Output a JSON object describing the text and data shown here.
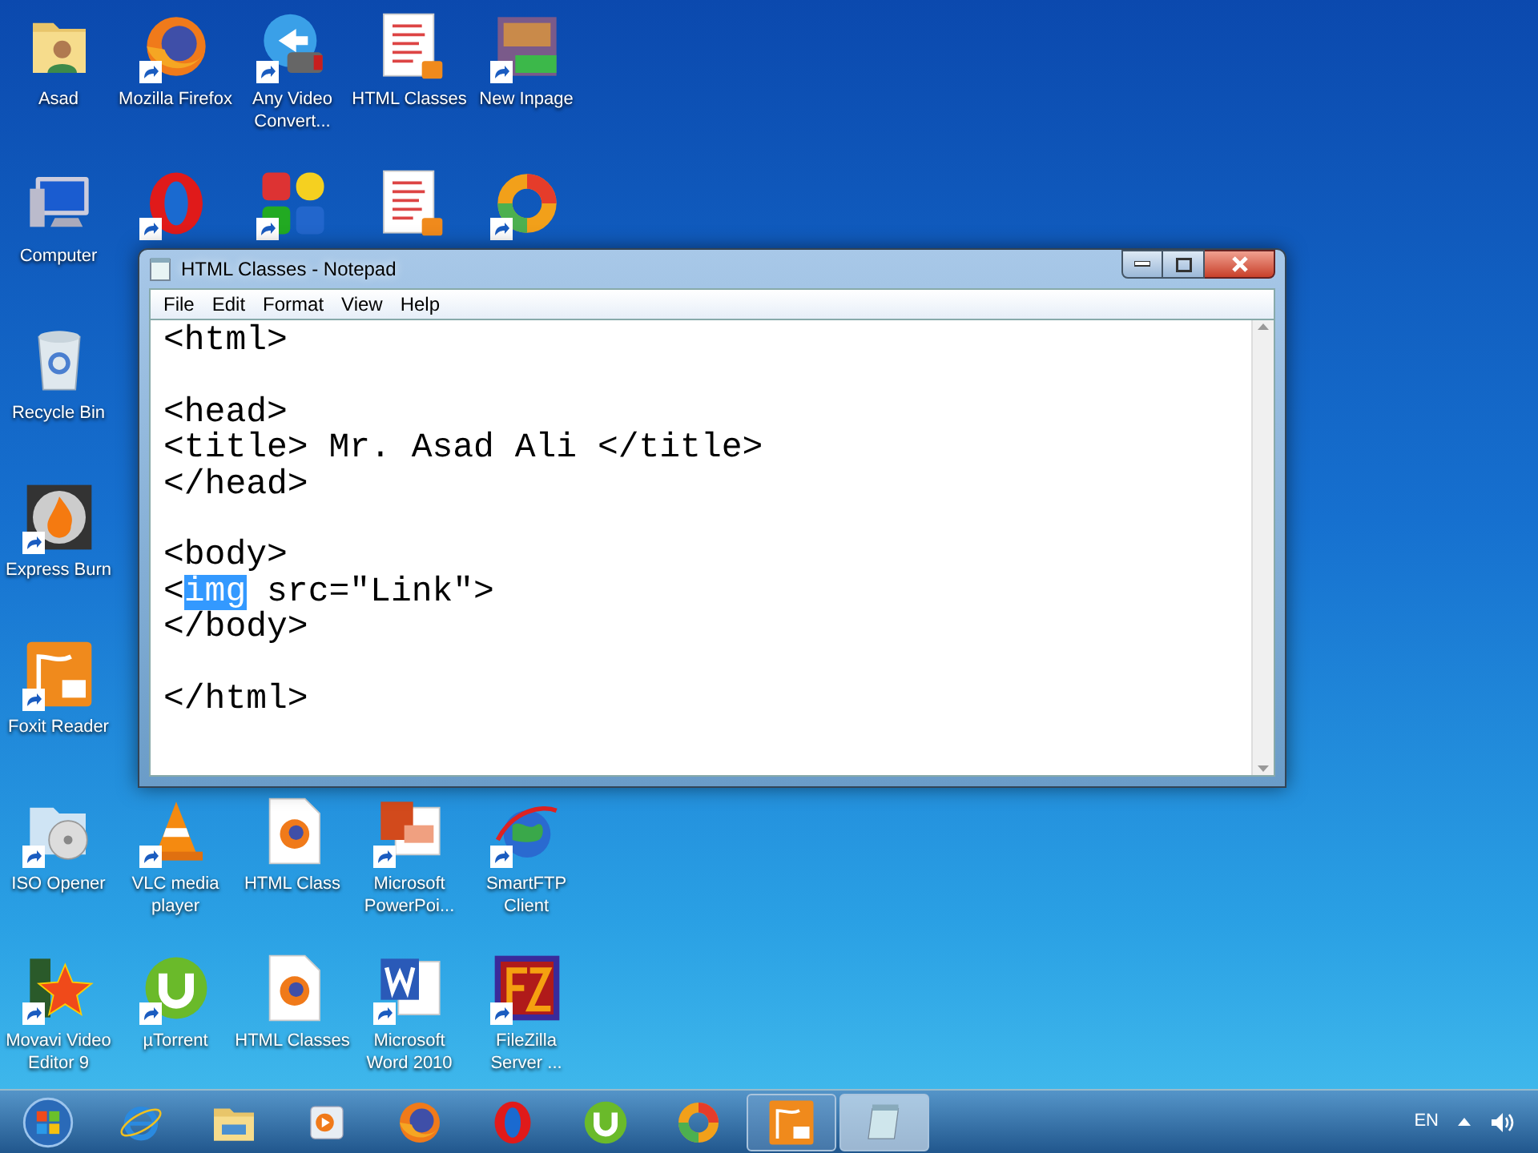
{
  "desktop": {
    "icon_rows": [
      [
        {
          "kind": "user-folder",
          "label": "Asad",
          "shortcut": false
        },
        {
          "kind": "firefox",
          "label": "Mozilla Firefox",
          "shortcut": true
        },
        {
          "kind": "video-converter",
          "label": "Any Video Convert...",
          "shortcut": true
        },
        {
          "kind": "pdf-doc",
          "label": "HTML Classes",
          "shortcut": false
        },
        {
          "kind": "inpage",
          "label": "New Inpage",
          "shortcut": true
        }
      ],
      [
        {
          "kind": "computer",
          "label": "Computer",
          "shortcut": false
        },
        {
          "kind": "opera",
          "shortcut": true
        },
        {
          "kind": "four-squares",
          "shortcut": true
        },
        {
          "kind": "pdf-doc",
          "shortcut": false
        },
        {
          "kind": "ring",
          "shortcut": true
        }
      ],
      [
        {
          "kind": "recycle-bin",
          "label": "Recycle Bin",
          "shortcut": false
        }
      ],
      [
        {
          "kind": "flame",
          "label": "Express Burn",
          "shortcut": true
        }
      ],
      [
        {
          "kind": "foxit",
          "label": "Foxit Reader",
          "shortcut": true
        }
      ],
      [
        {
          "kind": "disc-folder",
          "label": "ISO Opener",
          "shortcut": true
        },
        {
          "kind": "cone",
          "label": "VLC media player",
          "shortcut": true
        },
        {
          "kind": "web-doc",
          "label": "HTML Class",
          "shortcut": false
        },
        {
          "kind": "presentation",
          "label": "Microsoft PowerPoi...",
          "shortcut": true
        },
        {
          "kind": "globe",
          "label": "SmartFTP Client",
          "shortcut": true
        }
      ],
      [
        {
          "kind": "star-film",
          "label": "Movavi Video Editor 9",
          "shortcut": true
        },
        {
          "kind": "utorrent",
          "label": "µTorrent",
          "shortcut": true
        },
        {
          "kind": "web-doc",
          "label": "HTML Classes",
          "shortcut": false
        },
        {
          "kind": "word",
          "label": "Microsoft Word 2010",
          "shortcut": true
        },
        {
          "kind": "ftp-server",
          "label": "FileZilla Server ...",
          "shortcut": true
        }
      ]
    ]
  },
  "window": {
    "title": "HTML Classes - Notepad",
    "menu": [
      "File",
      "Edit",
      "Format",
      "View",
      "Help"
    ],
    "lines": [
      {
        "kind": "text",
        "segments": [
          {
            "text": "<html>",
            "selected": false
          }
        ]
      },
      {
        "kind": "blank"
      },
      {
        "kind": "text",
        "segments": [
          {
            "text": "<head>",
            "selected": false
          }
        ]
      },
      {
        "kind": "text",
        "segments": [
          {
            "text": "<title> Mr. Asad Ali </title>",
            "selected": false
          }
        ]
      },
      {
        "kind": "text",
        "segments": [
          {
            "text": "</head>",
            "selected": false
          }
        ]
      },
      {
        "kind": "blank"
      },
      {
        "kind": "text",
        "segments": [
          {
            "text": "<body>",
            "selected": false
          }
        ]
      },
      {
        "kind": "text",
        "segments": [
          {
            "text": "<",
            "selected": false
          },
          {
            "text": "img",
            "selected": true
          },
          {
            "text": " src=\"Link\">",
            "selected": false
          }
        ]
      },
      {
        "kind": "text",
        "segments": [
          {
            "text": "</body>",
            "selected": false
          }
        ]
      },
      {
        "kind": "blank"
      },
      {
        "kind": "text",
        "segments": [
          {
            "text": "</html>",
            "selected": false
          }
        ]
      }
    ]
  },
  "taskbar": {
    "items": [
      {
        "kind": "start",
        "running": false,
        "selected": false
      },
      {
        "kind": "ie",
        "running": false,
        "selected": false
      },
      {
        "kind": "explorer",
        "running": false,
        "selected": false
      },
      {
        "kind": "media",
        "running": false,
        "selected": false
      },
      {
        "kind": "firefox",
        "running": false,
        "selected": false
      },
      {
        "kind": "opera",
        "running": false,
        "selected": false
      },
      {
        "kind": "utorrent",
        "running": false,
        "selected": false
      },
      {
        "kind": "ring",
        "running": false,
        "selected": false
      },
      {
        "kind": "foxit",
        "running": true,
        "selected": false
      },
      {
        "kind": "notepad",
        "running": true,
        "selected": true
      }
    ],
    "language": "EN"
  }
}
